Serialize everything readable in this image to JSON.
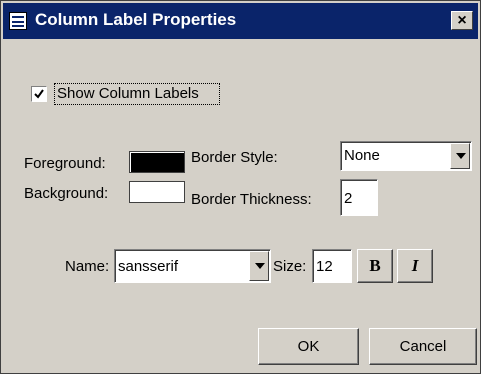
{
  "window": {
    "title": "Column Label Properties",
    "close_glyph": "×"
  },
  "show_labels": {
    "label": "Show Column Labels",
    "checked": true
  },
  "colors": {
    "foreground_label": "Foreground:",
    "foreground_value": "#000000",
    "background_label": "Background:",
    "background_value": "#ffffff"
  },
  "border": {
    "style_label": "Border Style:",
    "style_value": "None",
    "thickness_label": "Border Thickness:",
    "thickness_value": "2"
  },
  "font": {
    "name_label": "Name:",
    "name_value": "sansserif",
    "size_label": "Size:",
    "size_value": "12",
    "bold_label": "B",
    "italic_label": "I"
  },
  "buttons": {
    "ok": "OK",
    "cancel": "Cancel"
  },
  "icons": {
    "window": "dialog-window-icon",
    "checkbox": "checkmark-icon",
    "dropdown": "chevron-down-icon"
  }
}
